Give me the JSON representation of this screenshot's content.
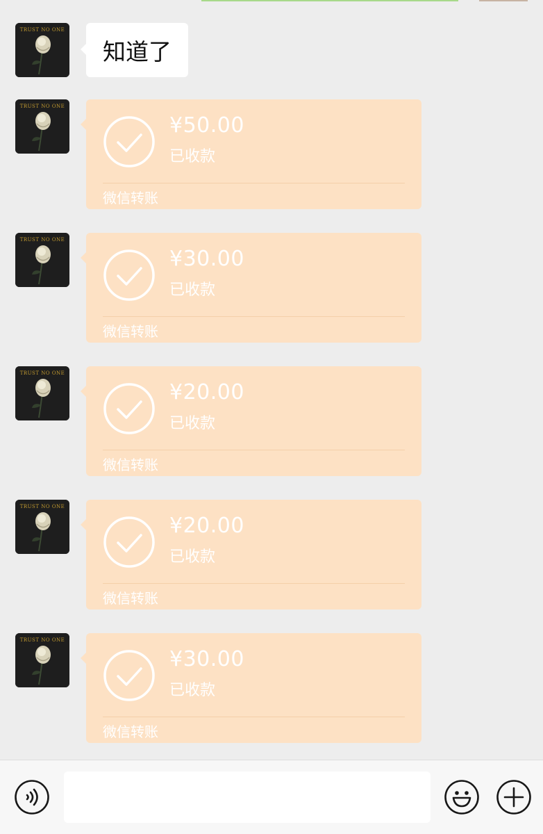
{
  "chat": {
    "messages": [
      {
        "type": "text",
        "avatar_text": "TRUST NO ONE",
        "text": "知道了"
      },
      {
        "type": "transfer",
        "avatar_text": "TRUST NO ONE",
        "amount": "¥50.00",
        "status": "已收款",
        "footer": "微信转账"
      },
      {
        "type": "transfer",
        "avatar_text": "TRUST NO ONE",
        "amount": "¥30.00",
        "status": "已收款",
        "footer": "微信转账"
      },
      {
        "type": "transfer",
        "avatar_text": "TRUST NO ONE",
        "amount": "¥20.00",
        "status": "已收款",
        "footer": "微信转账"
      },
      {
        "type": "transfer",
        "avatar_text": "TRUST NO ONE",
        "amount": "¥20.00",
        "status": "已收款",
        "footer": "微信转账"
      },
      {
        "type": "transfer",
        "avatar_text": "TRUST NO ONE",
        "amount": "¥30.00",
        "status": "已收款",
        "footer": "微信转账"
      }
    ]
  },
  "input_bar": {
    "input_value": "",
    "icons": [
      "voice-icon",
      "emoji-icon",
      "plus-icon"
    ]
  },
  "colors": {
    "background": "#ededed",
    "text_bubble": "#ffffff",
    "transfer_bubble": "#fde1c4",
    "transfer_text": "#ffffff",
    "input_bar": "#f7f7f7"
  }
}
